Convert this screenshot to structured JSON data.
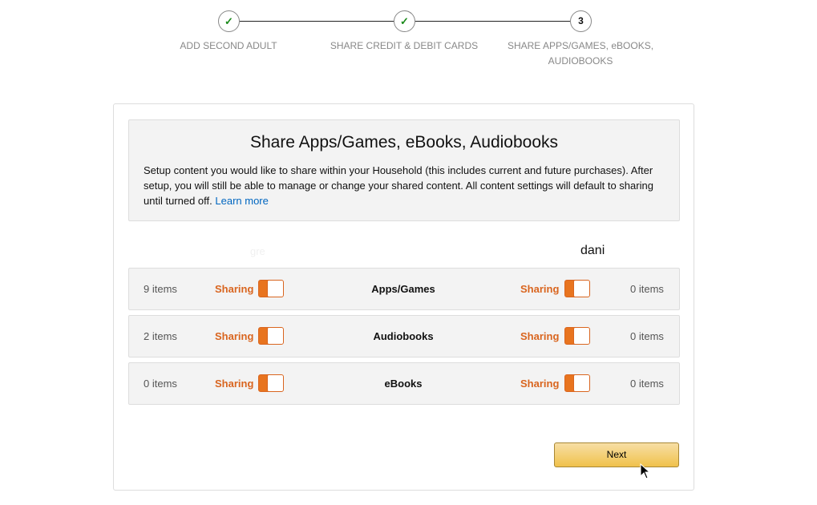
{
  "stepper": {
    "steps": [
      {
        "label": "ADD SECOND ADULT",
        "state": "done",
        "marker": "✓"
      },
      {
        "label": "SHARE CREDIT & DEBIT CARDS",
        "state": "done",
        "marker": "✓"
      },
      {
        "label_line1": "SHARE APPS/GAMES, eBOOKS,",
        "label_line2": "AUDIOBOOKS",
        "state": "current",
        "marker": "3"
      }
    ]
  },
  "intro": {
    "title": "Share Apps/Games, eBooks, Audiobooks",
    "text": "Setup content you would like to share within your Household (this includes current and future purchases).  After setup, you will still be able to manage or change your shared content.  All content settings will default to sharing until turned off. ",
    "learn_more": "Learn more"
  },
  "users": {
    "left": "gre",
    "right": "dani"
  },
  "rows": [
    {
      "category": "Apps/Games",
      "left_count": "9 items",
      "left_status": "Sharing",
      "left_on": true,
      "right_status": "Sharing",
      "right_on": true,
      "right_count": "0 items"
    },
    {
      "category": "Audiobooks",
      "left_count": "2 items",
      "left_status": "Sharing",
      "left_on": true,
      "right_status": "Sharing",
      "right_on": true,
      "right_count": "0 items"
    },
    {
      "category": "eBooks",
      "left_count": "0 items",
      "left_status": "Sharing",
      "left_on": true,
      "right_status": "Sharing",
      "right_on": true,
      "right_count": "0 items"
    }
  ],
  "next_label": "Next",
  "colors": {
    "accent": "#e8741f",
    "check": "#1a8a1a",
    "link": "#0066c0",
    "button": "#f0c14b"
  }
}
